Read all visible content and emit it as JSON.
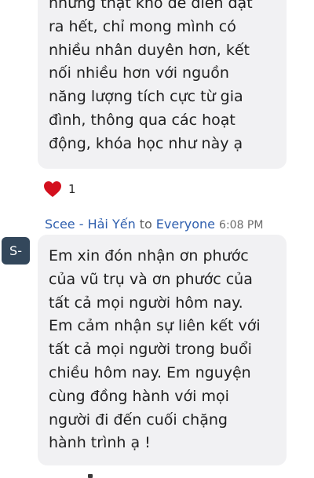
{
  "messages": [
    {
      "text": "những thật khó để diễn đạt\nra hết, chỉ mong mình có\nnhiều nhân duyên hơn, kết\nnối nhiều hơn với nguồn\nnăng lượng tích cực từ gia\nđình, thông qua các hoạt\nđộng, khóa học như này ạ",
      "reaction": {
        "icon": "heart-icon",
        "color": "#d3101e",
        "count": "1"
      }
    },
    {
      "sender": "Scee - Hải Yến",
      "to_label": "to",
      "recipient": "Everyone",
      "time": "6:08 PM",
      "avatar_initials": "S-",
      "avatar_color": "#33475b",
      "text": "Em xin đón nhận ơn phước\ncủa vũ trụ và ơn phước của\ntất cả mọi người hôm nay.\nEm cảm nhận sự liên kết với\ntất cả mọi người trong buổi\nchiều hôm nay. Em nguyện\ncùng đồng hành với mọi\nngười đi đến cuối chặng\nhành trình ạ !"
    }
  ]
}
